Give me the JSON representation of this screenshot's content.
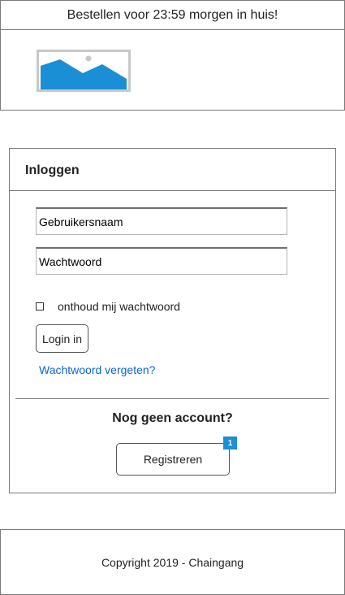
{
  "topbar": {
    "text": "Bestellen voor 23:59 morgen in huis!"
  },
  "header": {
    "logo_icon": "image-placeholder-icon"
  },
  "login": {
    "title": "Inloggen",
    "username_placeholder": "Gebruikersnaam",
    "password_placeholder": "Wachtwoord",
    "remember_label": "onthoud mij wachtwoord",
    "login_button": "Login in",
    "forgot_link": "Wachtwoord vergeten?",
    "no_account_heading": "Nog geen account?",
    "register_button": "Registreren",
    "register_badge": "1"
  },
  "footer": {
    "text": "Copyright 2019 - Chaingang"
  },
  "colors": {
    "accent": "#1a8fd6",
    "link": "#0a66d8",
    "border": "#7a7a7a"
  }
}
